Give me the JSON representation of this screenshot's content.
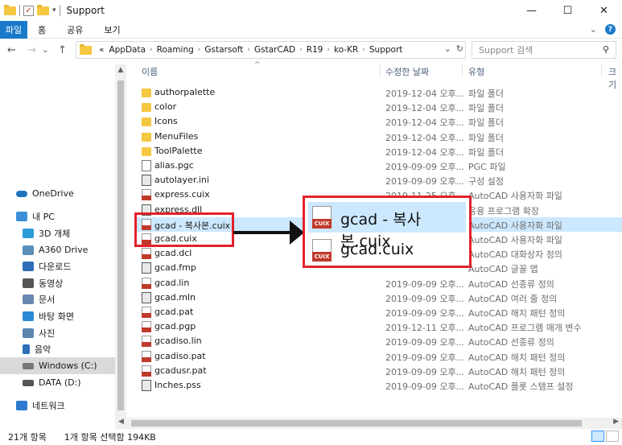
{
  "window": {
    "title": "Support",
    "controls": {
      "minimize": "—",
      "maximize": "☐",
      "close": "✕"
    }
  },
  "ribbon": {
    "tabs": [
      "파일",
      "홈",
      "공유",
      "보기"
    ],
    "expand_icon": "chevron-down",
    "help_label": "?"
  },
  "nav_buttons": {
    "back": "←",
    "forward": "→",
    "recent": "⌄",
    "up": "↑"
  },
  "address": {
    "prefix": "«",
    "crumbs": [
      "AppData",
      "Roaming",
      "Gstarsoft",
      "GstarCAD",
      "R19",
      "ko-KR",
      "Support"
    ],
    "refresh": "↻",
    "dropdown": "⌄"
  },
  "search": {
    "placeholder": "Support 검색",
    "icon": "search-icon"
  },
  "nav_pane": {
    "items": [
      {
        "label": "OneDrive",
        "icon": "cloud-icon",
        "color": "#1e73be"
      },
      {
        "label": "내 PC",
        "icon": "pc-icon",
        "color": "#3b8fd6"
      },
      {
        "label": "3D 개체",
        "icon": "cube-icon",
        "color": "#2b9ad8"
      },
      {
        "label": "A360 Drive",
        "icon": "drive-icon",
        "color": "#5a8fb8"
      },
      {
        "label": "다운로드",
        "icon": "download-icon",
        "color": "#2f6fb8"
      },
      {
        "label": "동영상",
        "icon": "video-icon",
        "color": "#555555"
      },
      {
        "label": "문서",
        "icon": "document-icon",
        "color": "#6a88b0"
      },
      {
        "label": "바탕 화면",
        "icon": "desktop-icon",
        "color": "#2b8ad8"
      },
      {
        "label": "사진",
        "icon": "picture-icon",
        "color": "#5b86b0"
      },
      {
        "label": "음악",
        "icon": "music-icon",
        "color": "#2f6fb8"
      },
      {
        "label": "Windows  (C:)",
        "icon": "drive-c-icon",
        "color": "#777777"
      },
      {
        "label": "DATA (D:)",
        "icon": "drive-d-icon",
        "color": "#555555"
      },
      {
        "label": "네트워크",
        "icon": "network-icon",
        "color": "#2b7ad0"
      }
    ]
  },
  "columns": {
    "name": "이름",
    "date": "수정한 날짜",
    "type": "유형",
    "size": "크기"
  },
  "files": [
    {
      "name": "authorpalette",
      "date": "2019-12-04 오후...",
      "type": "파일 폴더",
      "kind": "folder"
    },
    {
      "name": "color",
      "date": "2019-12-04 오후...",
      "type": "파일 폴더",
      "kind": "folder"
    },
    {
      "name": "Icons",
      "date": "2019-12-04 오후...",
      "type": "파일 폴더",
      "kind": "folder"
    },
    {
      "name": "MenuFiles",
      "date": "2019-12-04 오후...",
      "type": "파일 폴더",
      "kind": "folder"
    },
    {
      "name": "ToolPalette",
      "date": "2019-12-04 오후...",
      "type": "파일 폴더",
      "kind": "folder"
    },
    {
      "name": "alias.pgc",
      "date": "2019-09-09 오후...",
      "type": "PGC 파일",
      "kind": "doc"
    },
    {
      "name": "autolayer.ini",
      "date": "2019-09-09 오후...",
      "type": "구성 설정",
      "kind": "dark"
    },
    {
      "name": "express.cuix",
      "date": "2019-11-25 오후...",
      "type": "AutoCAD 사용자화 파일",
      "kind": "cad"
    },
    {
      "name": "express.dll",
      "date": "",
      "type": "응용 프로그램 확장",
      "kind": "dark"
    },
    {
      "name": "gcad - 복사본.cuix",
      "date": "",
      "type": "AutoCAD 사용자화 파일",
      "kind": "cad"
    },
    {
      "name": "gcad.cuix",
      "date": "",
      "type": "AutoCAD 사용자화 파일",
      "kind": "cad"
    },
    {
      "name": "gcad.dcl",
      "date": "",
      "type": "AutoCAD 대화상자 정의",
      "kind": "cad"
    },
    {
      "name": "gcad.fmp",
      "date": "",
      "type": "AutoCAD 글꼴 맵",
      "kind": "dark"
    },
    {
      "name": "gcad.lin",
      "date": "2019-09-09 오후...",
      "type": "AutoCAD 선종류 정의",
      "kind": "cad"
    },
    {
      "name": "gcad.mln",
      "date": "2019-09-09 오후...",
      "type": "AutoCAD 여러 줄 정의",
      "kind": "dark"
    },
    {
      "name": "gcad.pat",
      "date": "2019-09-09 오후...",
      "type": "AutoCAD 해치 패턴 정의",
      "kind": "cad"
    },
    {
      "name": "gcad.pgp",
      "date": "2019-12-11 오후...",
      "type": "AutoCAD 프로그램 매개 변수",
      "kind": "cad"
    },
    {
      "name": "gcadiso.lin",
      "date": "2019-09-09 오후...",
      "type": "AutoCAD 선종류 정의",
      "kind": "cad"
    },
    {
      "name": "gcadiso.pat",
      "date": "2019-09-09 오후...",
      "type": "AutoCAD 해치 패턴 정의",
      "kind": "cad"
    },
    {
      "name": "gcadusr.pat",
      "date": "2019-09-09 오후...",
      "type": "AutoCAD 해치 패턴 정의",
      "kind": "cad"
    },
    {
      "name": "Inches.pss",
      "date": "2019-09-09 오후...",
      "type": "AutoCAD 플롯 스탬프 설정",
      "kind": "dark"
    }
  ],
  "selected_index": 9,
  "zoom_callout": {
    "items": [
      "gcad - 복사본.cuix",
      "gcad.cuix"
    ]
  },
  "status": {
    "count": "21개 항목",
    "selection": "1개 항목 선택함 194KB"
  },
  "colors": {
    "accent": "#1979ca",
    "selection": "#cce8ff",
    "highlight": "#e3212b"
  }
}
